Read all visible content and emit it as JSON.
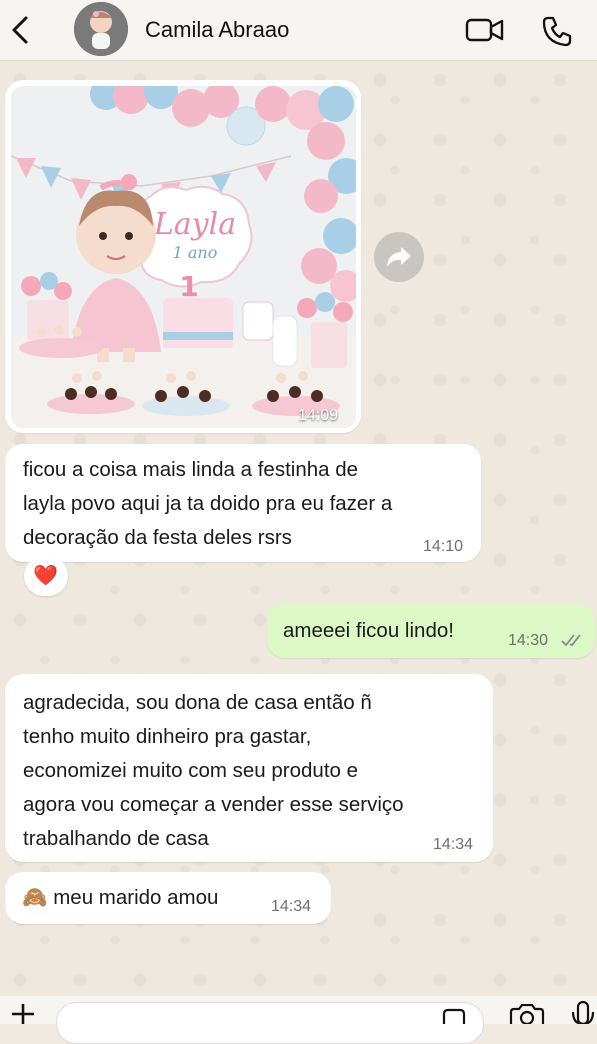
{
  "header": {
    "contact_name": "Camila Abraao",
    "icons": [
      "back-arrow-icon",
      "avatar",
      "video-call-icon",
      "phone-call-icon"
    ]
  },
  "messages": [
    {
      "direction": "incoming",
      "type": "image",
      "image_text": {
        "name": "Layla",
        "subtitle": "1 ano",
        "number": "1"
      },
      "time": "14:09"
    },
    {
      "direction": "incoming",
      "type": "text",
      "text": "ficou a coisa mais linda a festinha de\nlayla povo aqui ja ta doido pra eu fazer a\ndecoração da festa deles rsrs",
      "time": "14:10",
      "reaction": "❤️"
    },
    {
      "direction": "outgoing",
      "type": "text",
      "text": "ameeei ficou lindo!",
      "time": "14:30",
      "status": "read"
    },
    {
      "direction": "incoming",
      "type": "text",
      "text": "agradecida, sou dona de casa então ñ\ntenho muito dinheiro pra gastar,\neconomizei muito com seu produto e\nagora vou começar a vender esse serviço\ntrabalhando de casa",
      "time": "14:34"
    },
    {
      "direction": "incoming",
      "type": "text",
      "text": "🙈 meu marido amou",
      "time": "14:34"
    }
  ],
  "composer": {
    "icons": [
      "plus-icon",
      "sticker-icon",
      "camera-icon",
      "microphone-icon"
    ]
  },
  "colors": {
    "outgoing_bubble": "#dcf8c6",
    "incoming_bubble": "#ffffff",
    "read_ticks": "#8a8a8a",
    "header_bg": "#f7f5f2"
  }
}
